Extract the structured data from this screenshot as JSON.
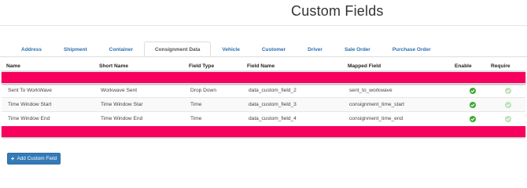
{
  "page": {
    "title": "Custom Fields"
  },
  "tabs": [
    {
      "label": "Address",
      "active": false
    },
    {
      "label": "Shipment",
      "active": false
    },
    {
      "label": "Container",
      "active": false
    },
    {
      "label": "Consignment Data",
      "active": true
    },
    {
      "label": "Vehicle",
      "active": false
    },
    {
      "label": "Customer",
      "active": false
    },
    {
      "label": "Driver",
      "active": false
    },
    {
      "label": "Sale Order",
      "active": false
    },
    {
      "label": "Purchase Order",
      "active": false
    }
  ],
  "table": {
    "headers": [
      "Name",
      "Short Name",
      "Field Type",
      "Field Name",
      "Mapped Field",
      "Enable",
      "Require"
    ],
    "rows": [
      {
        "name": "Sent To WorkWave",
        "short_name": "Workwave Sent",
        "field_type": "Drop Down",
        "field_name": "data_custom_field_2",
        "mapped_field": "sent_to_workwave",
        "enable": true,
        "require": false
      },
      {
        "name": "Time Window Start",
        "short_name": "Time Window Star",
        "field_type": "Time",
        "field_name": "data_custom_field_3",
        "mapped_field": "consignment_time_start",
        "enable": true,
        "require": false
      },
      {
        "name": "Time Window End",
        "short_name": "Time Window End",
        "field_type": "Time",
        "field_name": "data_custom_field_4",
        "mapped_field": "consignment_time_end",
        "enable": true,
        "require": false
      }
    ]
  },
  "actions": {
    "add_custom_field_label": "Add Custom Field"
  },
  "colors": {
    "highlight_row": "#f7005e",
    "link_blue": "#2a6fb2",
    "button_blue": "#337ab7",
    "check_enabled": "#3aa935",
    "check_disabled": "#b9e3b3"
  },
  "icons": {
    "enabled": "check-circle-icon",
    "add": "plus-icon"
  }
}
